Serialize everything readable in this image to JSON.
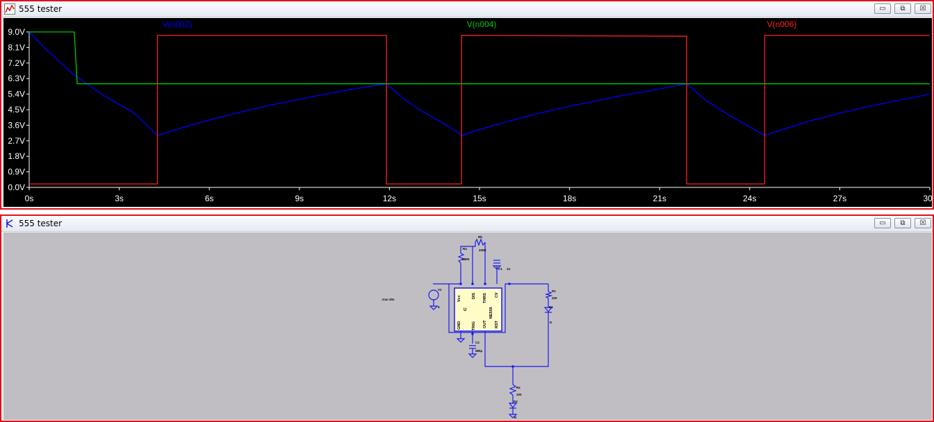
{
  "waveform_window": {
    "title": "555 tester",
    "buttons": {
      "minimize": "▭",
      "restore": "⧉",
      "close": "☒"
    },
    "icon": "waveform-icon"
  },
  "schematic_window": {
    "title": "555 tester",
    "buttons": {
      "minimize": "▭",
      "restore": "⧉",
      "close": "☒"
    },
    "icon": "schematic-icon",
    "directive": ".tran 30s",
    "ic_pins": {
      "vcc": "Vcc",
      "dis": "DIS",
      "thrs": "THRS",
      "cv": "CV",
      "gnd": "GND",
      "trig": "TRIG",
      "out": "OUT",
      "rst": "RST",
      "u": "U",
      "model": "NE555"
    },
    "labels": {
      "ra": "Ra",
      "ra_val": "680K",
      "rb": "Rb",
      "rb_val": "330K",
      "c1": "C1",
      "c1_val": "1n",
      "c2": "C2",
      "c2_val": "680µ",
      "v1": "V1",
      "v1_val": "9",
      "r1": "R1",
      "r1_val": "220",
      "r2": "R2",
      "r2_val": "220",
      "d1": "D1",
      "d1_val": "D",
      "d2": "D2",
      "d2_val": "D"
    }
  },
  "colors": {
    "background": "#000000",
    "grid": "#ffffff",
    "n002": "#0000ff",
    "n004": "#00c800",
    "n006": "#ff2020",
    "wire": "#1a1aee"
  },
  "chart_data": {
    "type": "line",
    "title": "",
    "xlabel": "",
    "ylabel": "",
    "xlim": [
      0,
      30
    ],
    "ylim": [
      0,
      9
    ],
    "x_ticks": [
      "0s",
      "3s",
      "6s",
      "9s",
      "12s",
      "15s",
      "18s",
      "21s",
      "24s",
      "27s",
      "30s"
    ],
    "y_ticks": [
      "0.0V",
      "0.9V",
      "1.8V",
      "2.7V",
      "3.6V",
      "4.5V",
      "5.4V",
      "6.3V",
      "7.2V",
      "8.1V",
      "9.0V"
    ],
    "legend_position": "top",
    "series": [
      {
        "name": "V(n002)",
        "color": "#0000ff",
        "points": [
          [
            0,
            9.0
          ],
          [
            0.5,
            8.1
          ],
          [
            1,
            7.3
          ],
          [
            1.5,
            6.5
          ],
          [
            2,
            5.9
          ],
          [
            2.5,
            5.3
          ],
          [
            3,
            4.8
          ],
          [
            3.5,
            4.3
          ],
          [
            4.27,
            3.0
          ],
          [
            5,
            3.4
          ],
          [
            6,
            3.9
          ],
          [
            7,
            4.35
          ],
          [
            8,
            4.75
          ],
          [
            9,
            5.1
          ],
          [
            10,
            5.45
          ],
          [
            11,
            5.75
          ],
          [
            11.9,
            6.0
          ],
          [
            12.5,
            5.1
          ],
          [
            13,
            4.5
          ],
          [
            13.5,
            4.0
          ],
          [
            14,
            3.5
          ],
          [
            14.4,
            3.0
          ],
          [
            15,
            3.35
          ],
          [
            16,
            3.85
          ],
          [
            17,
            4.3
          ],
          [
            18,
            4.7
          ],
          [
            19,
            5.05
          ],
          [
            20,
            5.4
          ],
          [
            21,
            5.7
          ],
          [
            21.9,
            6.0
          ],
          [
            22.5,
            5.1
          ],
          [
            23,
            4.5
          ],
          [
            23.5,
            4.0
          ],
          [
            24,
            3.5
          ],
          [
            24.5,
            3.0
          ],
          [
            25,
            3.3
          ],
          [
            26,
            3.85
          ],
          [
            27,
            4.3
          ],
          [
            28,
            4.7
          ],
          [
            29,
            5.05
          ],
          [
            30,
            5.4
          ]
        ]
      },
      {
        "name": "V(n004)",
        "color": "#00c800",
        "points": [
          [
            0,
            9.0
          ],
          [
            1.5,
            9.0
          ],
          [
            1.6,
            6.0
          ],
          [
            30,
            6.0
          ]
        ]
      },
      {
        "name": "V(n006)",
        "color": "#ff2020",
        "points": [
          [
            0,
            0.2
          ],
          [
            4.27,
            0.2
          ],
          [
            4.27,
            8.8
          ],
          [
            11.9,
            8.8
          ],
          [
            11.9,
            0.2
          ],
          [
            14.4,
            0.2
          ],
          [
            14.4,
            8.8
          ],
          [
            21.9,
            8.75
          ],
          [
            21.9,
            0.2
          ],
          [
            24.5,
            0.2
          ],
          [
            24.5,
            8.8
          ],
          [
            30,
            8.8
          ]
        ]
      }
    ]
  }
}
